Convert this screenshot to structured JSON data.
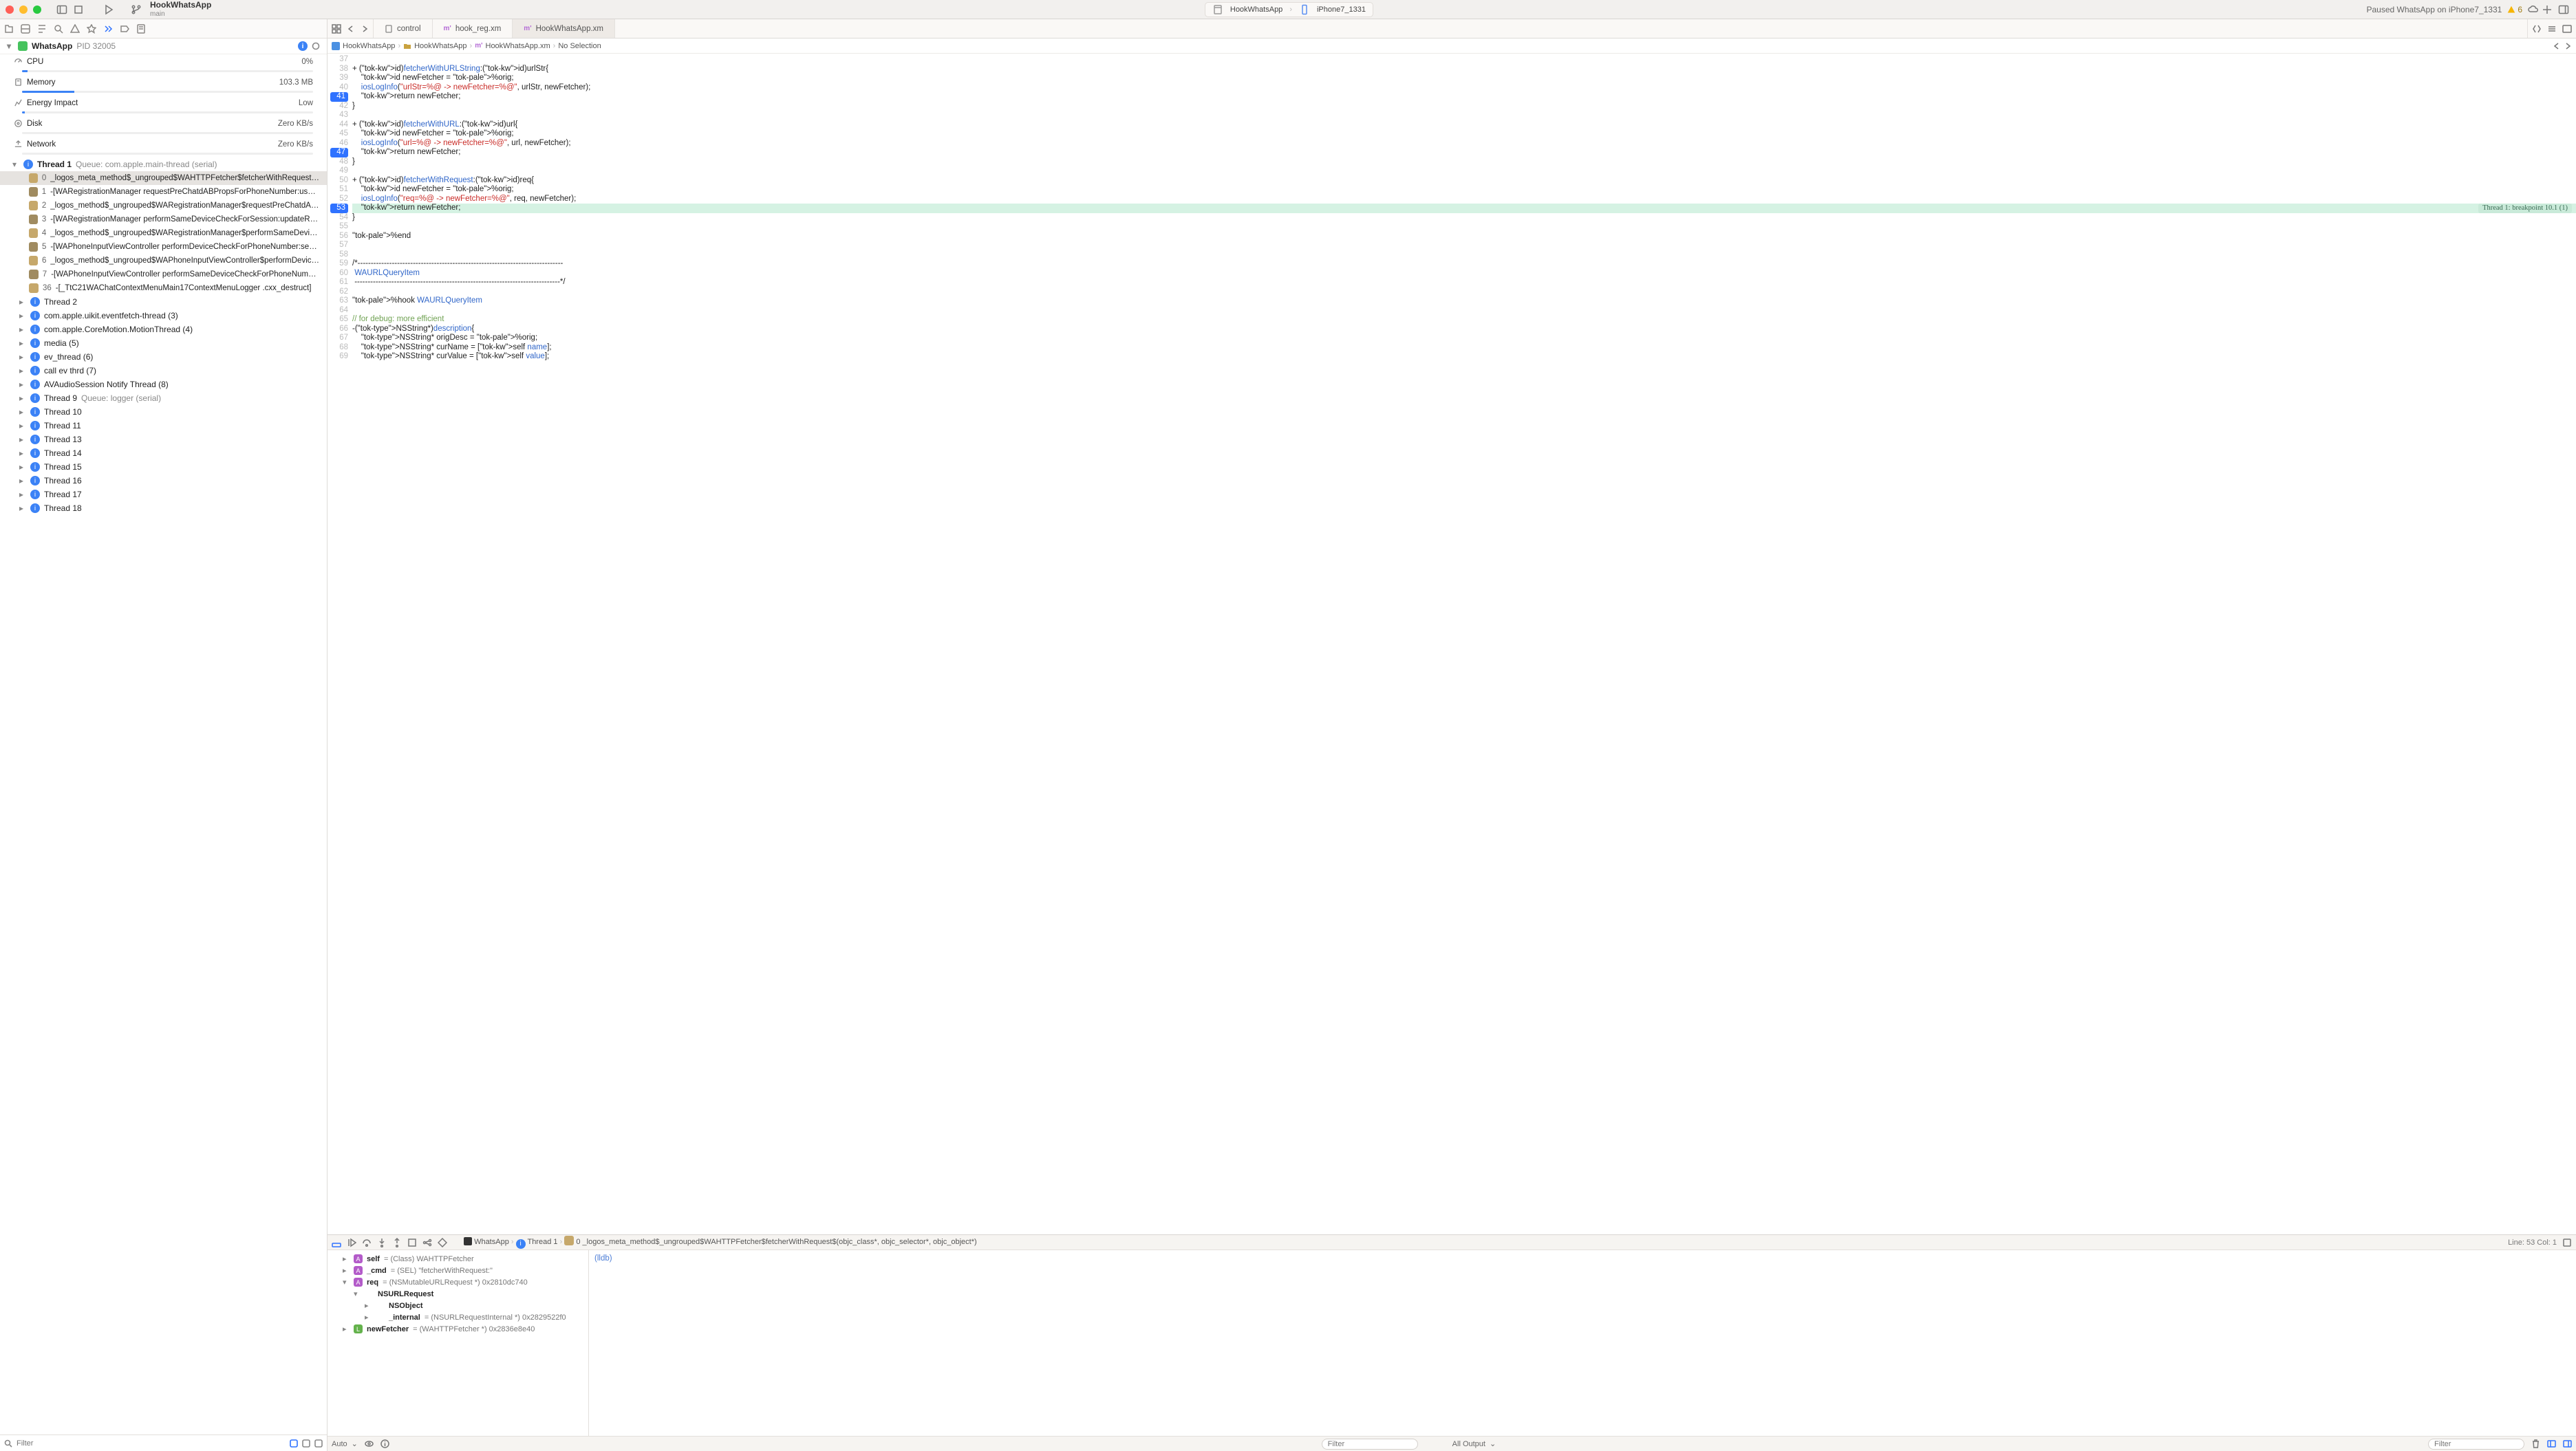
{
  "toolbar": {
    "scheme_name": "HookWhatsApp",
    "scheme_branch": "main",
    "target_left": "HookWhatsApp",
    "target_right": "iPhone7_1331",
    "status_text": "Paused WhatsApp on iPhone7_1331",
    "warning_count": "6"
  },
  "tabs": [
    {
      "label": "control",
      "active": false
    },
    {
      "label": "hook_reg.xm",
      "active": false
    },
    {
      "label": "HookWhatsApp.xm",
      "active": true
    }
  ],
  "jumpbar": {
    "items": [
      "HookWhatsApp",
      "HookWhatsApp",
      "HookWhatsApp.xm",
      "No Selection"
    ]
  },
  "navigator": {
    "process_name": "WhatsApp",
    "pid": "PID 32005",
    "gauges": [
      {
        "name": "CPU",
        "value": "0%",
        "fill": 2
      },
      {
        "name": "Memory",
        "value": "103.3 MB",
        "fill": 18
      },
      {
        "name": "Energy Impact",
        "value": "Low",
        "fill": 1
      },
      {
        "name": "Disk",
        "value": "Zero KB/s",
        "fill": 0
      },
      {
        "name": "Network",
        "value": "Zero KB/s",
        "fill": 0
      }
    ],
    "thread1_label": "Thread 1",
    "thread1_queue": "Queue: com.apple.main-thread (serial)",
    "stack": [
      {
        "n": "0",
        "t": "_logos_meta_method$_ungrouped$WAHTTPFetcher$fetcherWithRequest$(objc_...",
        "sel": true
      },
      {
        "n": "1",
        "t": "-[WARegistrationManager requestPreChatdABPropsForPhoneNumber:userContex..."
      },
      {
        "n": "2",
        "t": "_logos_method$_ungrouped$WARegistrationManager$requestPreChatdABProps..."
      },
      {
        "n": "3",
        "t": "-[WARegistrationManager performSameDeviceCheckForSession:updateRegistrati..."
      },
      {
        "n": "4",
        "t": "_logos_method$_ungrouped$WARegistrationManager$performSameDeviceChec..."
      },
      {
        "n": "5",
        "t": "-[WAPhoneInputViewController performDeviceCheckForPhoneNumber:session:is..."
      },
      {
        "n": "6",
        "t": "_logos_method$_ungrouped$WAPhoneInputViewController$performDeviceChec..."
      },
      {
        "n": "7",
        "t": "-[WAPhoneInputViewController performSameDeviceCheckForPhoneNumber:]"
      },
      {
        "n": "36",
        "t": "-[_TtC21WAChatContextMenuMain17ContextMenuLogger .cxx_destruct]"
      }
    ],
    "threads": [
      "Thread 2",
      "com.apple.uikit.eventfetch-thread (3)",
      "com.apple.CoreMotion.MotionThread (4)",
      "media (5)",
      "ev_thread (6)",
      "call ev thrd (7)",
      "AVAudioSession Notify Thread (8)",
      "Thread 9  Queue: logger (serial)",
      "Thread 10",
      "Thread 11",
      "Thread 13",
      "Thread 14",
      "Thread 15",
      "Thread 16",
      "Thread 17",
      "Thread 18"
    ],
    "filter_placeholder": "Filter"
  },
  "editor": {
    "first_line_no": 37,
    "breakpoint_lines": [
      41,
      47,
      53
    ],
    "highlight_line": 53,
    "highlight_label": "Thread 1: breakpoint 10.1 (1)",
    "lines": [
      "",
      "+ (id)fetcherWithURLString:(id)urlStr{",
      "    id newFetcher = %orig;",
      "    iosLogInfo(\"urlStr=%@ -> newFetcher=%@\", urlStr, newFetcher);",
      "    return newFetcher;",
      "}",
      "",
      "+ (id)fetcherWithURL:(id)url{",
      "    id newFetcher = %orig;",
      "    iosLogInfo(\"url=%@ -> newFetcher=%@\", url, newFetcher);",
      "    return newFetcher;",
      "}",
      "",
      "+ (id)fetcherWithRequest:(id)req{",
      "    id newFetcher = %orig;",
      "    iosLogInfo(\"req=%@ -> newFetcher=%@\", req, newFetcher);",
      "    return newFetcher;",
      "}",
      "",
      "%end",
      "",
      "",
      "/*------------------------------------------------------------------------------",
      " WAURLQueryItem",
      " ------------------------------------------------------------------------------*/",
      "",
      "%hook WAURLQueryItem",
      "",
      "// for debug: more efficient",
      "-(NSString*)description{",
      "    NSString* origDesc = %orig;",
      "    NSString* curName = [self name];",
      "    NSString* curValue = [self value];"
    ]
  },
  "debug": {
    "crumb_app": "WhatsApp",
    "crumb_thread": "Thread 1",
    "crumb_frame": "0 _logos_meta_method$_ungrouped$WAHTTPFetcher$fetcherWithRequest$(objc_class*, objc_selector*, objc_object*)",
    "pos": "Line: 53  Col: 1",
    "vars": [
      {
        "k": "A",
        "ind": 0,
        "name": "self",
        "rest": " = (Class) WAHTTPFetcher"
      },
      {
        "k": "A",
        "ind": 0,
        "name": "_cmd",
        "rest": " = (SEL) \"fetcherWithRequest:\""
      },
      {
        "k": "A",
        "ind": 0,
        "name": "req",
        "rest": " = (NSMutableURLRequest *) 0x2810dc740",
        "open": true
      },
      {
        "k": "",
        "ind": 1,
        "name": "NSURLRequest",
        "rest": "",
        "open": true
      },
      {
        "k": "",
        "ind": 2,
        "name": "NSObject",
        "rest": ""
      },
      {
        "k": "",
        "ind": 2,
        "name": "_internal",
        "rest": " = (NSURLRequestInternal *) 0x2829522f0"
      },
      {
        "k": "L",
        "ind": 0,
        "name": "newFetcher",
        "rest": " = (WAHTTPFetcher *) 0x2836e8e40"
      }
    ],
    "console_prompt": "(lldb)",
    "footer": {
      "auto": "Auto",
      "output": "All Output",
      "filter_placeholder": "Filter"
    }
  }
}
